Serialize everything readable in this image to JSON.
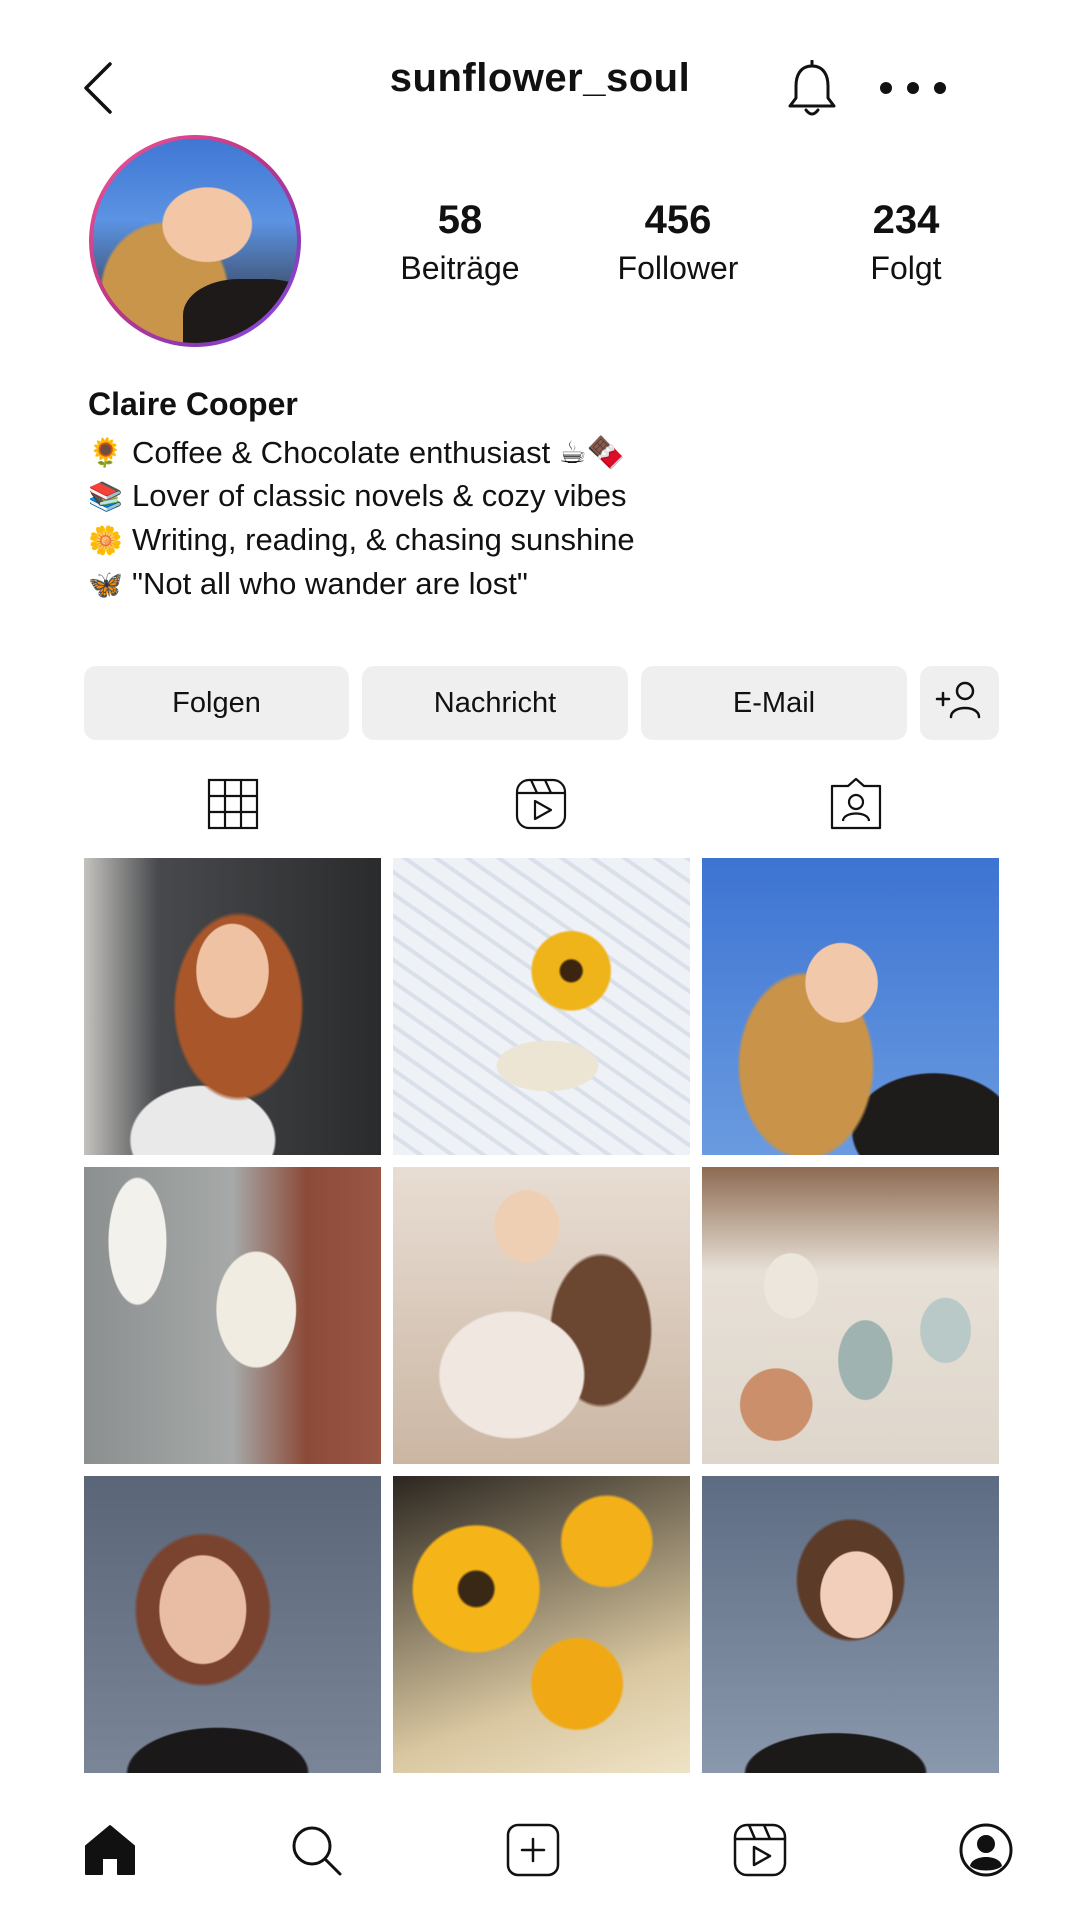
{
  "header": {
    "username": "sunflower_soul",
    "back_icon": "back-arrow-icon",
    "bell_icon": "bell-icon",
    "more_icon": "more-options-icon"
  },
  "profile": {
    "stats": [
      {
        "value": "58",
        "label": "Beiträge"
      },
      {
        "value": "456",
        "label": "Follower"
      },
      {
        "value": "234",
        "label": "Folgt"
      }
    ],
    "name": "Claire Cooper",
    "bio": [
      {
        "emoji": "🌻",
        "text": "Coffee & Chocolate enthusiast ☕🍫"
      },
      {
        "emoji": "📚",
        "text": "Lover of classic novels & cozy vibes"
      },
      {
        "emoji": "🌼",
        "text": "Writing, reading, & chasing sunshine"
      },
      {
        "emoji": "🦋",
        "text": "\"Not all who wander are lost\""
      }
    ]
  },
  "actions": {
    "follow": "Folgen",
    "message": "Nachricht",
    "email": "E-Mail"
  },
  "tabs": [
    "grid-icon",
    "reels-icon",
    "tagged-icon"
  ],
  "grid_posts": [
    {
      "caption": ""
    },
    {
      "caption": ""
    },
    {
      "caption": ""
    },
    {
      "caption": ""
    },
    {
      "caption": ""
    },
    {
      "caption": ""
    },
    {
      "caption": ""
    },
    {
      "caption": ""
    },
    {
      "caption": ""
    }
  ],
  "nav": [
    "home-icon",
    "search-icon",
    "create-icon",
    "reels-icon",
    "profile-icon"
  ],
  "colors": {
    "avatar_ring_start": "#f0589b",
    "avatar_ring_end": "#8f54f0",
    "button_bg": "#efefef"
  }
}
